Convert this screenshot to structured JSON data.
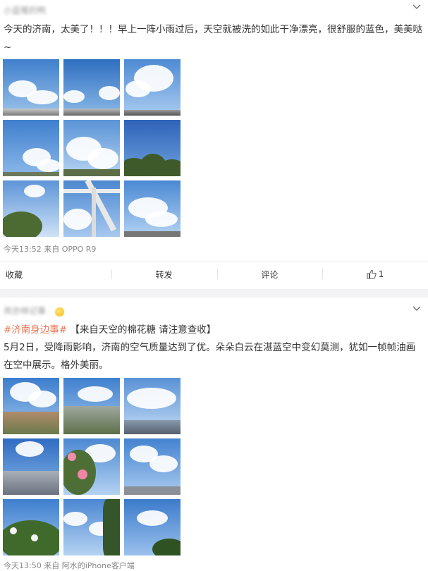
{
  "post1": {
    "author": "小蓝莓的鸭",
    "text": "今天的济南，太美了！！！早上一阵小雨过后，天空就被洗的如此干净漂亮，很舒服的蓝色，美美哒~",
    "time_source": "今天13:52 来自 OPPO R9",
    "actions": {
      "favorite": "收藏",
      "repost": "转发",
      "comment": "评论",
      "like_count": "1"
    }
  },
  "post2": {
    "author": "岚亦林记事",
    "hashtag": "#济南身边事#",
    "title": "【来自天空的棉花糖 请注意查收】",
    "text": "5月2日，受降雨影响，济南的空气质量达到了优。朵朵白云在湛蓝空中变幻莫测，犹如一帧帧油画在空中展示。格外美丽。",
    "time_prefix": "今天13:50 来自",
    "source": "阿水的iPhone客户端"
  },
  "icons": {
    "chevron": "chevron-down-icon",
    "like": "thumbs-up-icon",
    "vip": "vip-badge-icon"
  },
  "colors": {
    "hashtag": "#eb7350",
    "sky_blue": "#4a86d0",
    "separator": "#f2f2f5"
  }
}
